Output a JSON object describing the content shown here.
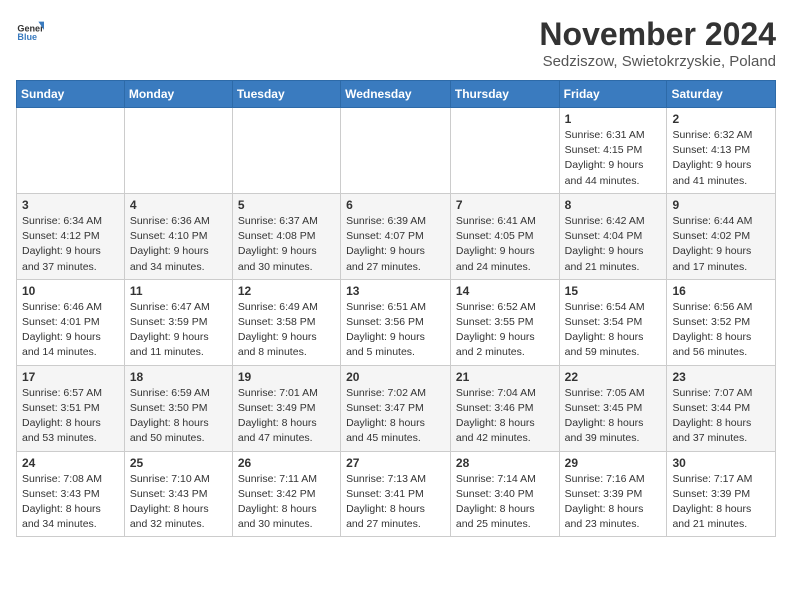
{
  "logo": {
    "text_general": "General",
    "text_blue": "Blue"
  },
  "header": {
    "month": "November 2024",
    "location": "Sedziszow, Swietokrzyskie, Poland"
  },
  "weekdays": [
    "Sunday",
    "Monday",
    "Tuesday",
    "Wednesday",
    "Thursday",
    "Friday",
    "Saturday"
  ],
  "weeks": [
    [
      {
        "day": "",
        "info": ""
      },
      {
        "day": "",
        "info": ""
      },
      {
        "day": "",
        "info": ""
      },
      {
        "day": "",
        "info": ""
      },
      {
        "day": "",
        "info": ""
      },
      {
        "day": "1",
        "info": "Sunrise: 6:31 AM\nSunset: 4:15 PM\nDaylight: 9 hours\nand 44 minutes."
      },
      {
        "day": "2",
        "info": "Sunrise: 6:32 AM\nSunset: 4:13 PM\nDaylight: 9 hours\nand 41 minutes."
      }
    ],
    [
      {
        "day": "3",
        "info": "Sunrise: 6:34 AM\nSunset: 4:12 PM\nDaylight: 9 hours\nand 37 minutes."
      },
      {
        "day": "4",
        "info": "Sunrise: 6:36 AM\nSunset: 4:10 PM\nDaylight: 9 hours\nand 34 minutes."
      },
      {
        "day": "5",
        "info": "Sunrise: 6:37 AM\nSunset: 4:08 PM\nDaylight: 9 hours\nand 30 minutes."
      },
      {
        "day": "6",
        "info": "Sunrise: 6:39 AM\nSunset: 4:07 PM\nDaylight: 9 hours\nand 27 minutes."
      },
      {
        "day": "7",
        "info": "Sunrise: 6:41 AM\nSunset: 4:05 PM\nDaylight: 9 hours\nand 24 minutes."
      },
      {
        "day": "8",
        "info": "Sunrise: 6:42 AM\nSunset: 4:04 PM\nDaylight: 9 hours\nand 21 minutes."
      },
      {
        "day": "9",
        "info": "Sunrise: 6:44 AM\nSunset: 4:02 PM\nDaylight: 9 hours\nand 17 minutes."
      }
    ],
    [
      {
        "day": "10",
        "info": "Sunrise: 6:46 AM\nSunset: 4:01 PM\nDaylight: 9 hours\nand 14 minutes."
      },
      {
        "day": "11",
        "info": "Sunrise: 6:47 AM\nSunset: 3:59 PM\nDaylight: 9 hours\nand 11 minutes."
      },
      {
        "day": "12",
        "info": "Sunrise: 6:49 AM\nSunset: 3:58 PM\nDaylight: 9 hours\nand 8 minutes."
      },
      {
        "day": "13",
        "info": "Sunrise: 6:51 AM\nSunset: 3:56 PM\nDaylight: 9 hours\nand 5 minutes."
      },
      {
        "day": "14",
        "info": "Sunrise: 6:52 AM\nSunset: 3:55 PM\nDaylight: 9 hours\nand 2 minutes."
      },
      {
        "day": "15",
        "info": "Sunrise: 6:54 AM\nSunset: 3:54 PM\nDaylight: 8 hours\nand 59 minutes."
      },
      {
        "day": "16",
        "info": "Sunrise: 6:56 AM\nSunset: 3:52 PM\nDaylight: 8 hours\nand 56 minutes."
      }
    ],
    [
      {
        "day": "17",
        "info": "Sunrise: 6:57 AM\nSunset: 3:51 PM\nDaylight: 8 hours\nand 53 minutes."
      },
      {
        "day": "18",
        "info": "Sunrise: 6:59 AM\nSunset: 3:50 PM\nDaylight: 8 hours\nand 50 minutes."
      },
      {
        "day": "19",
        "info": "Sunrise: 7:01 AM\nSunset: 3:49 PM\nDaylight: 8 hours\nand 47 minutes."
      },
      {
        "day": "20",
        "info": "Sunrise: 7:02 AM\nSunset: 3:47 PM\nDaylight: 8 hours\nand 45 minutes."
      },
      {
        "day": "21",
        "info": "Sunrise: 7:04 AM\nSunset: 3:46 PM\nDaylight: 8 hours\nand 42 minutes."
      },
      {
        "day": "22",
        "info": "Sunrise: 7:05 AM\nSunset: 3:45 PM\nDaylight: 8 hours\nand 39 minutes."
      },
      {
        "day": "23",
        "info": "Sunrise: 7:07 AM\nSunset: 3:44 PM\nDaylight: 8 hours\nand 37 minutes."
      }
    ],
    [
      {
        "day": "24",
        "info": "Sunrise: 7:08 AM\nSunset: 3:43 PM\nDaylight: 8 hours\nand 34 minutes."
      },
      {
        "day": "25",
        "info": "Sunrise: 7:10 AM\nSunset: 3:43 PM\nDaylight: 8 hours\nand 32 minutes."
      },
      {
        "day": "26",
        "info": "Sunrise: 7:11 AM\nSunset: 3:42 PM\nDaylight: 8 hours\nand 30 minutes."
      },
      {
        "day": "27",
        "info": "Sunrise: 7:13 AM\nSunset: 3:41 PM\nDaylight: 8 hours\nand 27 minutes."
      },
      {
        "day": "28",
        "info": "Sunrise: 7:14 AM\nSunset: 3:40 PM\nDaylight: 8 hours\nand 25 minutes."
      },
      {
        "day": "29",
        "info": "Sunrise: 7:16 AM\nSunset: 3:39 PM\nDaylight: 8 hours\nand 23 minutes."
      },
      {
        "day": "30",
        "info": "Sunrise: 7:17 AM\nSunset: 3:39 PM\nDaylight: 8 hours\nand 21 minutes."
      }
    ]
  ]
}
